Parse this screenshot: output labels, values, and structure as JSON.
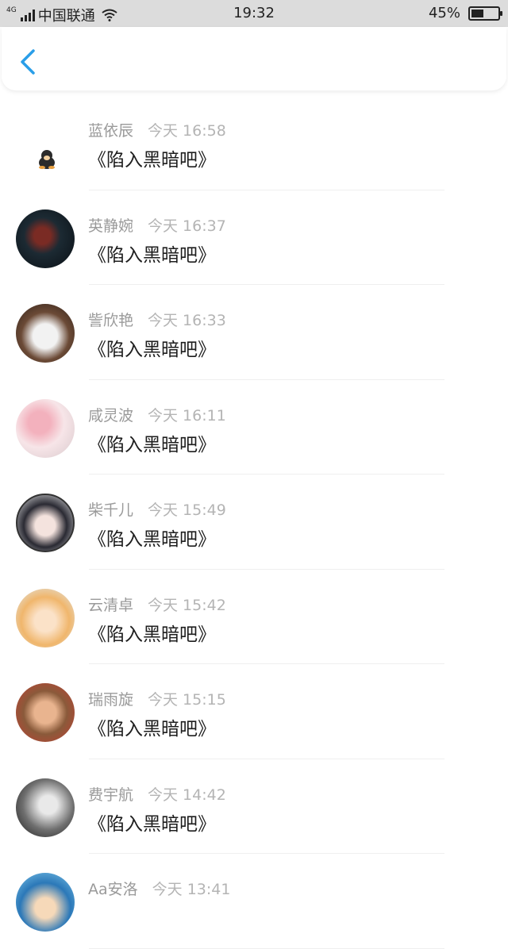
{
  "status_bar": {
    "network": "4G",
    "carrier": "中国联通",
    "time": "19:32",
    "battery": "45%",
    "battery_level": 0.45
  },
  "nav": {
    "back_icon": "chevron-left-icon",
    "accent_color": "#2a9ee8"
  },
  "messages": [
    {
      "name": "蓝依辰",
      "time": "今天 16:58",
      "text": "《陷入黑暗吧》"
    },
    {
      "name": "英静婉",
      "time": "今天 16:37",
      "text": "《陷入黑暗吧》"
    },
    {
      "name": "訾欣艳",
      "time": "今天 16:33",
      "text": "《陷入黑暗吧》"
    },
    {
      "name": "咸灵波",
      "time": "今天 16:11",
      "text": "《陷入黑暗吧》"
    },
    {
      "name": "柴千儿",
      "time": "今天 15:49",
      "text": "《陷入黑暗吧》"
    },
    {
      "name": "云清卓",
      "time": "今天 15:42",
      "text": "《陷入黑暗吧》"
    },
    {
      "name": "瑞雨旋",
      "time": "今天 15:15",
      "text": "《陷入黑暗吧》"
    },
    {
      "name": "费宇航",
      "time": "今天 14:42",
      "text": "《陷入黑暗吧》"
    },
    {
      "name": "Aa安洛",
      "time": "今天 13:41",
      "text": ""
    }
  ]
}
